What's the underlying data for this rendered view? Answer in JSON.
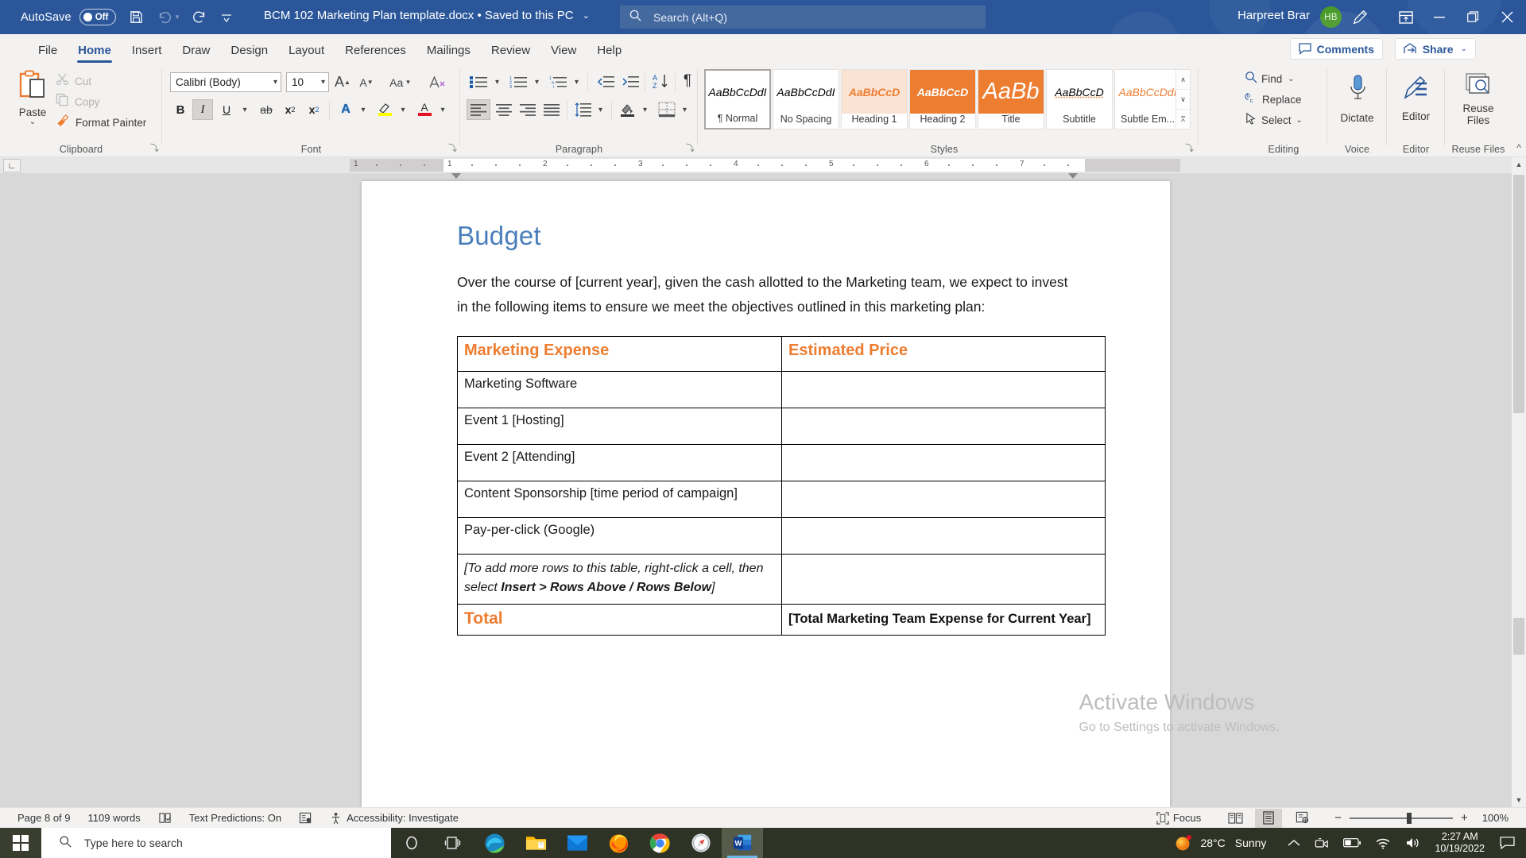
{
  "titlebar": {
    "autosave_label": "AutoSave",
    "autosave_state": "Off",
    "save_icon": "save-icon",
    "undo_icon": "undo-icon",
    "redo_icon": "redo-icon",
    "customize_icon": "customize-quick-access-icon",
    "document_title": "BCM 102 Marketing Plan template.docx • Saved to this PC",
    "title_chevron": "⌄",
    "search_placeholder": "Search (Alt+Q)",
    "search_icon": "search-icon",
    "user_name": "Harpreet Brar",
    "user_initials": "HB",
    "pen_icon": "ink-pen-icon",
    "ribbon_display_icon": "ribbon-display-options-icon",
    "minimize_icon": "minimize-icon",
    "restore_icon": "restore-icon",
    "close_icon": "close-icon",
    "accent": "#2b579a"
  },
  "tabs": [
    {
      "label": "File",
      "active": false
    },
    {
      "label": "Home",
      "active": true
    },
    {
      "label": "Insert",
      "active": false
    },
    {
      "label": "Draw",
      "active": false
    },
    {
      "label": "Design",
      "active": false
    },
    {
      "label": "Layout",
      "active": false
    },
    {
      "label": "References",
      "active": false
    },
    {
      "label": "Mailings",
      "active": false
    },
    {
      "label": "Review",
      "active": false
    },
    {
      "label": "View",
      "active": false
    },
    {
      "label": "Help",
      "active": false
    }
  ],
  "tabbar_right": {
    "comments_label": "Comments",
    "comments_icon": "comment-icon",
    "share_label": "Share",
    "share_icon": "share-icon",
    "share_chevron": "⌄"
  },
  "ribbon": {
    "clipboard": {
      "group_label": "Clipboard",
      "paste_label": "Paste",
      "paste_chevron": "⌄",
      "paste_icon": "paste-icon",
      "cut_label": "Cut",
      "cut_icon": "scissors-icon",
      "copy_label": "Copy",
      "copy_icon": "copy-icon",
      "format_painter_label": "Format Painter",
      "format_painter_icon": "format-painter-icon",
      "dialog_launcher": "⤵"
    },
    "font": {
      "group_label": "Font",
      "font_name": "Calibri (Body)",
      "font_size": "10",
      "grow_font_icon": "grow-font-icon",
      "shrink_font_icon": "shrink-font-icon",
      "change_case_icon": "change-case-icon",
      "clear_formatting_icon": "clear-formatting-icon",
      "bold_label": "B",
      "italic_label": "I",
      "underline_label": "U",
      "strikethrough_icon": "strikethrough-icon",
      "subscript_label": "x",
      "superscript_label": "x",
      "text_effects_icon": "text-effects-icon",
      "highlight_icon": "text-highlight-icon",
      "font_color_icon": "font-color-icon",
      "italic_active": true,
      "dialog_launcher": "⤵"
    },
    "paragraph": {
      "group_label": "Paragraph",
      "bullets_icon": "bullet-list-icon",
      "numbering_icon": "numbered-list-icon",
      "multilevel_icon": "multilevel-list-icon",
      "decrease_indent_icon": "decrease-indent-icon",
      "increase_indent_icon": "increase-indent-icon",
      "sort_icon": "sort-icon",
      "show_marks_icon": "show-formatting-marks-icon",
      "align_left_icon": "align-left-icon",
      "align_center_icon": "align-center-icon",
      "align_right_icon": "align-right-icon",
      "justify_icon": "justify-icon",
      "line_spacing_icon": "line-spacing-icon",
      "shading_icon": "shading-icon",
      "borders_icon": "borders-icon",
      "dialog_launcher": "⤵"
    },
    "styles": {
      "group_label": "Styles",
      "dialog_launcher": "⤵",
      "scroll_up": "∧",
      "scroll_down": "∨",
      "scroll_more": "⩞",
      "items": [
        {
          "sample": "AaBbCcDdI",
          "name": "¶ Normal",
          "active": true
        },
        {
          "sample": "AaBbCcDdI",
          "name": "No Spacing",
          "active": false
        },
        {
          "sample": "AaBbCcD",
          "name": "Heading 1",
          "active": false
        },
        {
          "sample": "AaBbCcD",
          "name": "Heading 2",
          "active": false
        },
        {
          "sample": "AaBb",
          "name": "Title",
          "active": false
        },
        {
          "sample": "AaBbCcD",
          "name": "Subtitle",
          "active": false
        },
        {
          "sample": "AaBbCcDdI",
          "name": "Subtle Em...",
          "active": false
        }
      ]
    },
    "editing": {
      "group_label": "Editing",
      "find_label": "Find",
      "find_icon": "search-icon",
      "find_chevron": "⌄",
      "replace_label": "Replace",
      "replace_icon": "replace-icon",
      "select_label": "Select",
      "select_icon": "cursor-select-icon",
      "select_chevron": "⌄"
    },
    "voice": {
      "group_label": "Voice",
      "dictate_label": "Dictate",
      "dictate_icon": "microphone-icon"
    },
    "editor_group": {
      "group_label": "Editor",
      "editor_label": "Editor",
      "editor_icon": "editor-pencil-icon"
    },
    "reuse": {
      "group_label": "Reuse Files",
      "reuse_label_line1": "Reuse",
      "reuse_label_line2": "Files",
      "reuse_icon": "reuse-files-icon"
    },
    "collapse_ribbon_icon": "collapse-ribbon-chevron-icon"
  },
  "ruler": {
    "tab_selector_icon": "tab-stop-left-icon",
    "numbers": [
      "1",
      "2",
      "3",
      "4",
      "5",
      "6",
      "7"
    ]
  },
  "document": {
    "heading": "Budget",
    "heading_color": "#4a7ebb",
    "paragraph": "Over the course of [current year], given the cash allotted to the Marketing team, we expect to invest in the following items to ensure we meet the objectives outlined in this marketing plan:",
    "table": {
      "accent_color": "#ED7D31",
      "headers": [
        "Marketing Expense",
        "Estimated Price"
      ],
      "rows": [
        {
          "expense": "Marketing Software",
          "price": ""
        },
        {
          "expense": "Event 1 [Hosting]",
          "price": ""
        },
        {
          "expense": "Event 2 [Attending]",
          "price": ""
        },
        {
          "expense": "Content Sponsorship [time period of campaign]",
          "price": ""
        },
        {
          "expense": "Pay-per-click (Google)",
          "price": ""
        }
      ],
      "note_row": {
        "part1": "[To add more rows to this table, right-click a cell, then select ",
        "bold1": "Insert > Rows Above / Rows Below",
        "part2": "]",
        "price": ""
      },
      "total_row": {
        "label": "Total",
        "value": "[Total Marketing Team Expense for Current Year]"
      }
    }
  },
  "watermark": {
    "line1": "Activate Windows",
    "line2": "Go to Settings to activate Windows."
  },
  "statusbar": {
    "page_info": "Page 8 of 9",
    "word_count": "1109 words",
    "proofing_icon": "proofing-errors-icon",
    "text_predictions": "Text Predictions: On",
    "display_settings_icon": "display-settings-icon",
    "accessibility_icon": "accessibility-icon",
    "accessibility_label": "Accessibility: Investigate",
    "focus_label": "Focus",
    "focus_icon": "focus-mode-icon",
    "read_mode_icon": "read-mode-icon",
    "print_layout_icon": "print-layout-icon",
    "web_layout_icon": "web-layout-icon",
    "zoom_out": "−",
    "zoom_in": "+",
    "zoom_level": "100%"
  },
  "taskbar": {
    "start_icon": "windows-start-icon",
    "search_placeholder": "Type here to search",
    "search_icon": "search-icon",
    "apps": [
      {
        "name": "cortana-icon"
      },
      {
        "name": "task-view-icon"
      },
      {
        "name": "microsoft-edge-icon"
      },
      {
        "name": "file-explorer-icon"
      },
      {
        "name": "mail-icon"
      },
      {
        "name": "firefox-icon"
      },
      {
        "name": "google-chrome-icon"
      },
      {
        "name": "safari-icon"
      },
      {
        "name": "microsoft-word-icon"
      }
    ],
    "weather_temp": "28°C",
    "weather_desc": "Sunny",
    "tray_expand_icon": "show-hidden-icons-icon",
    "meet_now_icon": "meet-now-icon",
    "battery_icon": "battery-icon",
    "wifi_icon": "wifi-icon",
    "volume_icon": "volume-icon",
    "time": "2:27 AM",
    "date": "10/19/2022",
    "action_center_icon": "action-center-icon"
  }
}
